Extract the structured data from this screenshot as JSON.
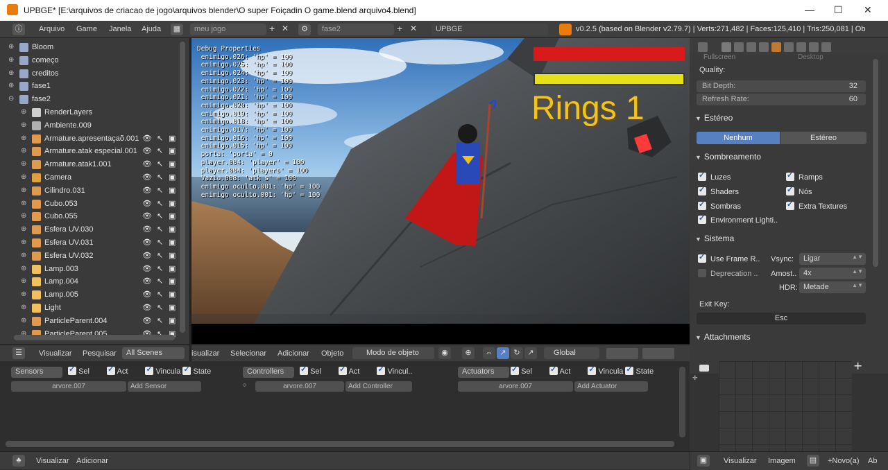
{
  "window": {
    "title": "UPBGE* [E:\\arquivos de criacao de jogo\\arquivos blender\\O super Foiçadin O game.blend arquivo4.blend]",
    "min": "—",
    "max": "☐",
    "close": "✕"
  },
  "topbar": {
    "menus": [
      "Arquivo",
      "Game",
      "Janela",
      "Ajuda"
    ],
    "screen": "meu jogo",
    "scene": "fase2",
    "engine": "UPBGE",
    "stats": "v0.2.5 (based on Blender v2.79.7) | Verts:271,482 | Faces:125,410 | Tris:250,081 | Ob"
  },
  "outliner": {
    "rows": [
      {
        "name": "Bloom",
        "level": 0,
        "icon": "scene-icon",
        "vis": false
      },
      {
        "name": "começo",
        "level": 0,
        "icon": "scene-icon",
        "vis": false
      },
      {
        "name": "creditos",
        "level": 0,
        "icon": "scene-icon",
        "vis": false
      },
      {
        "name": "fase1",
        "level": 0,
        "icon": "scene-icon",
        "vis": false
      },
      {
        "name": "fase2",
        "level": 0,
        "icon": "scene-icon",
        "vis": false,
        "open": true
      },
      {
        "name": "RenderLayers",
        "level": 1,
        "icon": "render-layers-icon",
        "vis": false
      },
      {
        "name": "Ambiente.009",
        "level": 1,
        "icon": "world-icon",
        "vis": false
      },
      {
        "name": "Armature.apresentaçaõ.001",
        "level": 1,
        "icon": "armature-icon",
        "vis": true
      },
      {
        "name": "Armature.atak especial.001",
        "level": 1,
        "icon": "armature-icon",
        "vis": true
      },
      {
        "name": "Armature.atak1.001",
        "level": 1,
        "icon": "armature-icon",
        "vis": true
      },
      {
        "name": "Camera",
        "level": 1,
        "icon": "camera-icon",
        "vis": true
      },
      {
        "name": "Cilindro.031",
        "level": 1,
        "icon": "mesh-icon",
        "vis": true
      },
      {
        "name": "Cubo.053",
        "level": 1,
        "icon": "mesh-icon",
        "vis": true
      },
      {
        "name": "Cubo.055",
        "level": 1,
        "icon": "mesh-icon",
        "vis": true
      },
      {
        "name": "Esfera UV.030",
        "level": 1,
        "icon": "mesh-icon",
        "vis": true
      },
      {
        "name": "Esfera UV.031",
        "level": 1,
        "icon": "mesh-icon",
        "vis": true
      },
      {
        "name": "Esfera UV.032",
        "level": 1,
        "icon": "mesh-icon",
        "vis": true
      },
      {
        "name": "Lamp.003",
        "level": 1,
        "icon": "lamp-icon",
        "vis": true
      },
      {
        "name": "Lamp.004",
        "level": 1,
        "icon": "lamp-icon",
        "vis": true
      },
      {
        "name": "Lamp.005",
        "level": 1,
        "icon": "lamp-icon",
        "vis": true
      },
      {
        "name": "Light",
        "level": 1,
        "icon": "lamp-icon",
        "vis": true
      },
      {
        "name": "ParticleParent.004",
        "level": 1,
        "icon": "empty-icon",
        "vis": true
      },
      {
        "name": "ParticleParent.005",
        "level": 1,
        "icon": "empty-icon",
        "vis": true
      }
    ],
    "header": {
      "view": "Visualizar",
      "search": "Pesquisar",
      "filter": "All Scenes"
    }
  },
  "viewport": {
    "debug_title": "Debug Properties",
    "debug_lines": [
      "enimigo.026: 'hp' = 100",
      "enimigo.025: 'hp' = 100",
      "enimigo.024: 'hp' = 100",
      "enimigo.023: 'hp' = 100",
      "enimigo.022: 'hp' = 100",
      "enimigo.021: 'hp' = 100",
      "enimigo.020: 'hp' = 100",
      "enimigo.019: 'hp' = 100",
      "enimigo.018: 'hp' = 100",
      "enimigo.017: 'hp' = 100",
      "enimigo.016: 'hp' = 100",
      "enimigo.015: 'hp' = 100",
      "porta: 'porta' = 0",
      "player.004: 'player' = 100",
      "player.004: 'players' = 100",
      "Vazio.008: 'atk s' = 100",
      "enimigo oculto.001: 'hp' = 100",
      "enimigo oculto.001: 'hp' = 100"
    ],
    "hud_text": "Rings 1",
    "health_color": "#d81a1a",
    "energy_color": "#e6e01a",
    "header": {
      "menus": [
        "isualizar",
        "Selecionar",
        "Adicionar",
        "Objeto"
      ],
      "mode": "Modo de objeto",
      "orientation": "Global"
    }
  },
  "logic": {
    "sensors": {
      "title": "Sensors",
      "sel": "Sel",
      "act": "Act",
      "link": "Vincula",
      "state": "State",
      "object": "arvore.007",
      "add": "Add Sensor"
    },
    "controllers": {
      "title": "Controllers",
      "sel": "Sel",
      "act": "Act",
      "link": "Vincul..",
      "object": "arvore.007",
      "add": "Add Controller"
    },
    "actuators": {
      "title": "Actuators",
      "sel": "Sel",
      "act": "Act",
      "link": "Vincula",
      "state": "State",
      "object": "arvore.007",
      "add": "Add Actuator"
    }
  },
  "props": {
    "top_partial": "Fullscreen",
    "top_partial2": "Desktop",
    "quality_label": "Quality:",
    "bit_depth_label": "Bit Depth:",
    "bit_depth": "32",
    "refresh_label": "Refresh Rate:",
    "refresh": "60",
    "stereo_title": "Estéreo",
    "stereo_none": "Nenhum",
    "stereo_on": "Estéreo",
    "shading_title": "Sombreamento",
    "shading": [
      "Luzes",
      "Ramps",
      "Shaders",
      "Nós",
      "Sombras",
      "Extra Textures",
      "Environment Lighti.."
    ],
    "system_title": "Sistema",
    "use_frame": "Use Frame R..",
    "deprecation": "Deprecation ..",
    "vsync_label": "Vsync:",
    "vsync": "Ligar",
    "samples_label": "Amost..",
    "samples": "4x",
    "hdr_label": "HDR:",
    "hdr": "Metade",
    "exit_key_label": "Exit Key:",
    "exit_key": "Esc",
    "attachments_title": "Attachments"
  },
  "bottombar": {
    "left_view": "Visualizar",
    "left_add": "Adicionar",
    "right_view": "Visualizar",
    "right_image": "Imagem",
    "right_new": "+Novo(a)",
    "right_open": "Ab"
  }
}
